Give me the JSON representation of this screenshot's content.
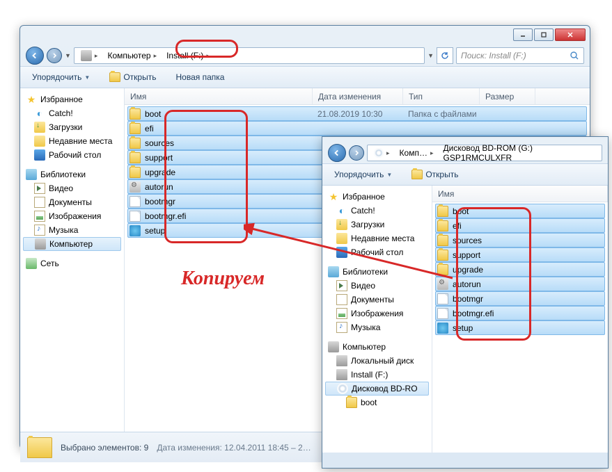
{
  "win1": {
    "crumbs": [
      "Компьютер",
      "Install (F:)"
    ],
    "search_placeholder": "Поиск: Install (F:)",
    "toolbar": {
      "organize": "Упорядочить",
      "open": "Открыть",
      "newfolder": "Новая папка"
    },
    "nav": {
      "favorites": "Избранное",
      "favitems": [
        "Catch!",
        "Загрузки",
        "Недавние места",
        "Рабочий стол"
      ],
      "libraries": "Библиотеки",
      "libitems": [
        "Видео",
        "Документы",
        "Изображения",
        "Музыка"
      ],
      "computer": "Компьютер",
      "network": "Сеть"
    },
    "cols": {
      "name": "Имя",
      "modified": "Дата изменения",
      "type": "Тип",
      "size": "Размер"
    },
    "rows": [
      {
        "name": "boot",
        "icon": "folder",
        "modified": "21.08.2019 10:30",
        "type": "Папка с файлами"
      },
      {
        "name": "efi",
        "icon": "folder"
      },
      {
        "name": "sources",
        "icon": "folder"
      },
      {
        "name": "support",
        "icon": "folder"
      },
      {
        "name": "upgrade",
        "icon": "folder"
      },
      {
        "name": "autorun",
        "icon": "cfg"
      },
      {
        "name": "bootmgr",
        "icon": "file"
      },
      {
        "name": "bootmgr.efi",
        "icon": "file"
      },
      {
        "name": "setup",
        "icon": "app"
      }
    ],
    "status": {
      "sel": "Выбрано элементов: 9",
      "mod_label": "Дата изменения:",
      "mod_val": "12.04.2011 18:45 – 2…"
    }
  },
  "win2": {
    "crumbs_short": "Комп…",
    "crumbs_path": "Дисковод BD-ROM (G:) GSP1RMCULXFR",
    "toolbar": {
      "organize": "Упорядочить",
      "open": "Открыть"
    },
    "nav": {
      "favorites": "Избранное",
      "favitems": [
        "Catch!",
        "Загрузки",
        "Недавние места",
        "Рабочий стол"
      ],
      "libraries": "Библиотеки",
      "libitems": [
        "Видео",
        "Документы",
        "Изображения",
        "Музыка"
      ],
      "computer": "Компьютер",
      "compitems": [
        "Локальный диск",
        "Install (F:)",
        "Дисковод BD-RO",
        "boot"
      ]
    },
    "cols": {
      "name": "Имя"
    },
    "rows": [
      {
        "name": "boot",
        "icon": "folder"
      },
      {
        "name": "efi",
        "icon": "folder"
      },
      {
        "name": "sources",
        "icon": "folder"
      },
      {
        "name": "support",
        "icon": "folder"
      },
      {
        "name": "upgrade",
        "icon": "folder"
      },
      {
        "name": "autorun",
        "icon": "cfg"
      },
      {
        "name": "bootmgr",
        "icon": "file"
      },
      {
        "name": "bootmgr.efi",
        "icon": "file"
      },
      {
        "name": "setup",
        "icon": "app"
      }
    ]
  },
  "annotation": "Копируем"
}
